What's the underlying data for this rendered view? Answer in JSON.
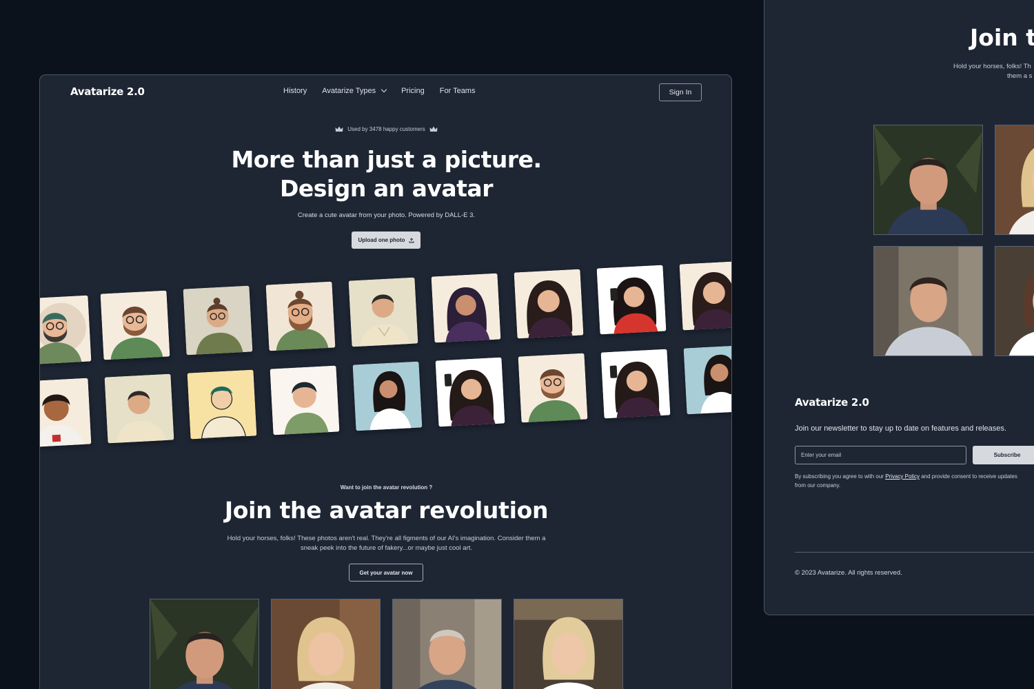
{
  "brand": {
    "name": "Avatarize 2.0"
  },
  "nav": {
    "items": [
      "History",
      "Avatarize Types",
      "Pricing",
      "For Teams"
    ],
    "signin_label": "Sign In"
  },
  "hero": {
    "badge": "Used by 3478 happy customers",
    "title_line1": "More than just a picture.",
    "title_line2": "Design an avatar",
    "subtitle": "Create a cute avatar from your photo. Powered by DALL-E 3.",
    "upload_label": "Upload one photo"
  },
  "gallery": {
    "row1": [
      "bearded-man-green-shirt",
      "bearded-man-glasses-green",
      "man-glasses-olive",
      "bearded-man-bun",
      "young-man-cream-shirt",
      "woman-purple-top",
      "woman-long-hair",
      "woman-selfie-red",
      "woman-long-hair-purple"
    ],
    "row2": [
      "boy-curly-hair",
      "young-man-cream-shirt",
      "man-yellow-background",
      "man-green-shirt",
      "woman-white-shirt",
      "woman-selfie-purple",
      "bearded-man-glasses-green",
      "woman-selfie-purple",
      "woman-white-shirt"
    ]
  },
  "join": {
    "eyebrow": "Want to join the avatar revolution ?",
    "title": "Join the avatar revolution",
    "subtitle": "Hold your horses, folks! These photos aren't real. They're all figments of our AI's imagination. Consider them a sneak peek into the future of fakery...or maybe just cool art.",
    "cta_label": "Get your avatar now"
  },
  "side": {
    "title": "Join t",
    "subtitle_line1": "Hold your horses, folks! Th",
    "subtitle_line2": "them a s",
    "newsletter_text": "Join our newsletter to stay up to date on features and releases.",
    "email_placeholder": "Enter your email",
    "subscribe_label": "Subscribe",
    "consent_before": "By subscribing you agree to with our ",
    "privacy_link": "Privacy Policy",
    "consent_after": " and provide consent to receive updates from our company.",
    "copyright": "© 2023 Avatarize. All rights reserved."
  },
  "colors": {
    "background": "#0c121b",
    "panel": "#1e2634",
    "border": "#4b5567",
    "button_light": "#d6d9de"
  }
}
